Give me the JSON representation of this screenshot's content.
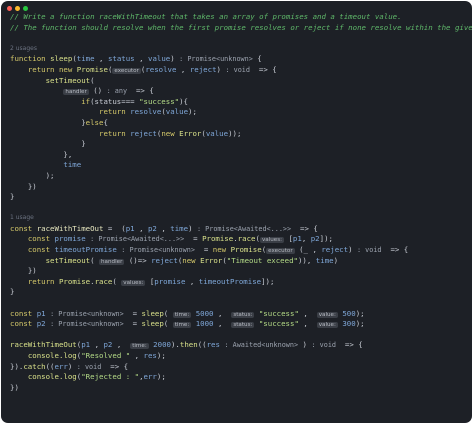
{
  "window": {
    "traffic_lights": [
      {
        "name": "close",
        "color": "#ff5f57"
      },
      {
        "name": "minimize",
        "color": "#febc2e"
      },
      {
        "name": "maximize",
        "color": "#28c840"
      }
    ]
  },
  "comments": {
    "line1": "// Write a function raceWithTimeout that takes an array of promises and a timeout value.",
    "line2": "// The function should resolve when the first promise resolves or reject if none resolve within the given timeout."
  },
  "usages": {
    "sleep": "2 usages",
    "race": "1 usage"
  },
  "hints": {
    "executor": "executor",
    "handler": "handler",
    "values": "values:",
    "time": "time:",
    "status": "status:",
    "value": "value:"
  },
  "tokens": {
    "const": "const",
    "function": "function",
    "return": "return",
    "new": "new",
    "if": "if",
    "else": "else",
    "sleep": "sleep",
    "time": "time",
    "status": "status",
    "value": "value",
    "Promise": "Promise",
    "promise_unknown": "Promise<unknown>",
    "void": ": void",
    "any": ": any",
    "resolve": "resolve",
    "reject": "reject",
    "setTimeout": "setTimeout",
    "success_cmp": "(status=== ",
    "success_str": "\"success\"",
    "Error": "Error",
    "raceWithTimeOut": "raceWithTimeOut",
    "p1": "p1",
    "p2": "p2",
    "promise_awaited": "Promise<Awaited<...>>",
    "promise": "promise",
    "timeoutPromise": "timeoutPromise",
    "race": "race",
    "timeout_msg": "\"Timeout exceed\"",
    "num5000": "5000",
    "num1000": "1000",
    "num500": "500",
    "num300": "300",
    "num2000": "2000",
    "then": "then",
    "res": "res",
    "res_awaited": ": Awaited<unknown>",
    "console_log": "console.log",
    "resolved_str": "\"Resolved \"",
    "catch": "catch",
    "err": "err",
    "rejected_str": "\"Rejected : \""
  }
}
